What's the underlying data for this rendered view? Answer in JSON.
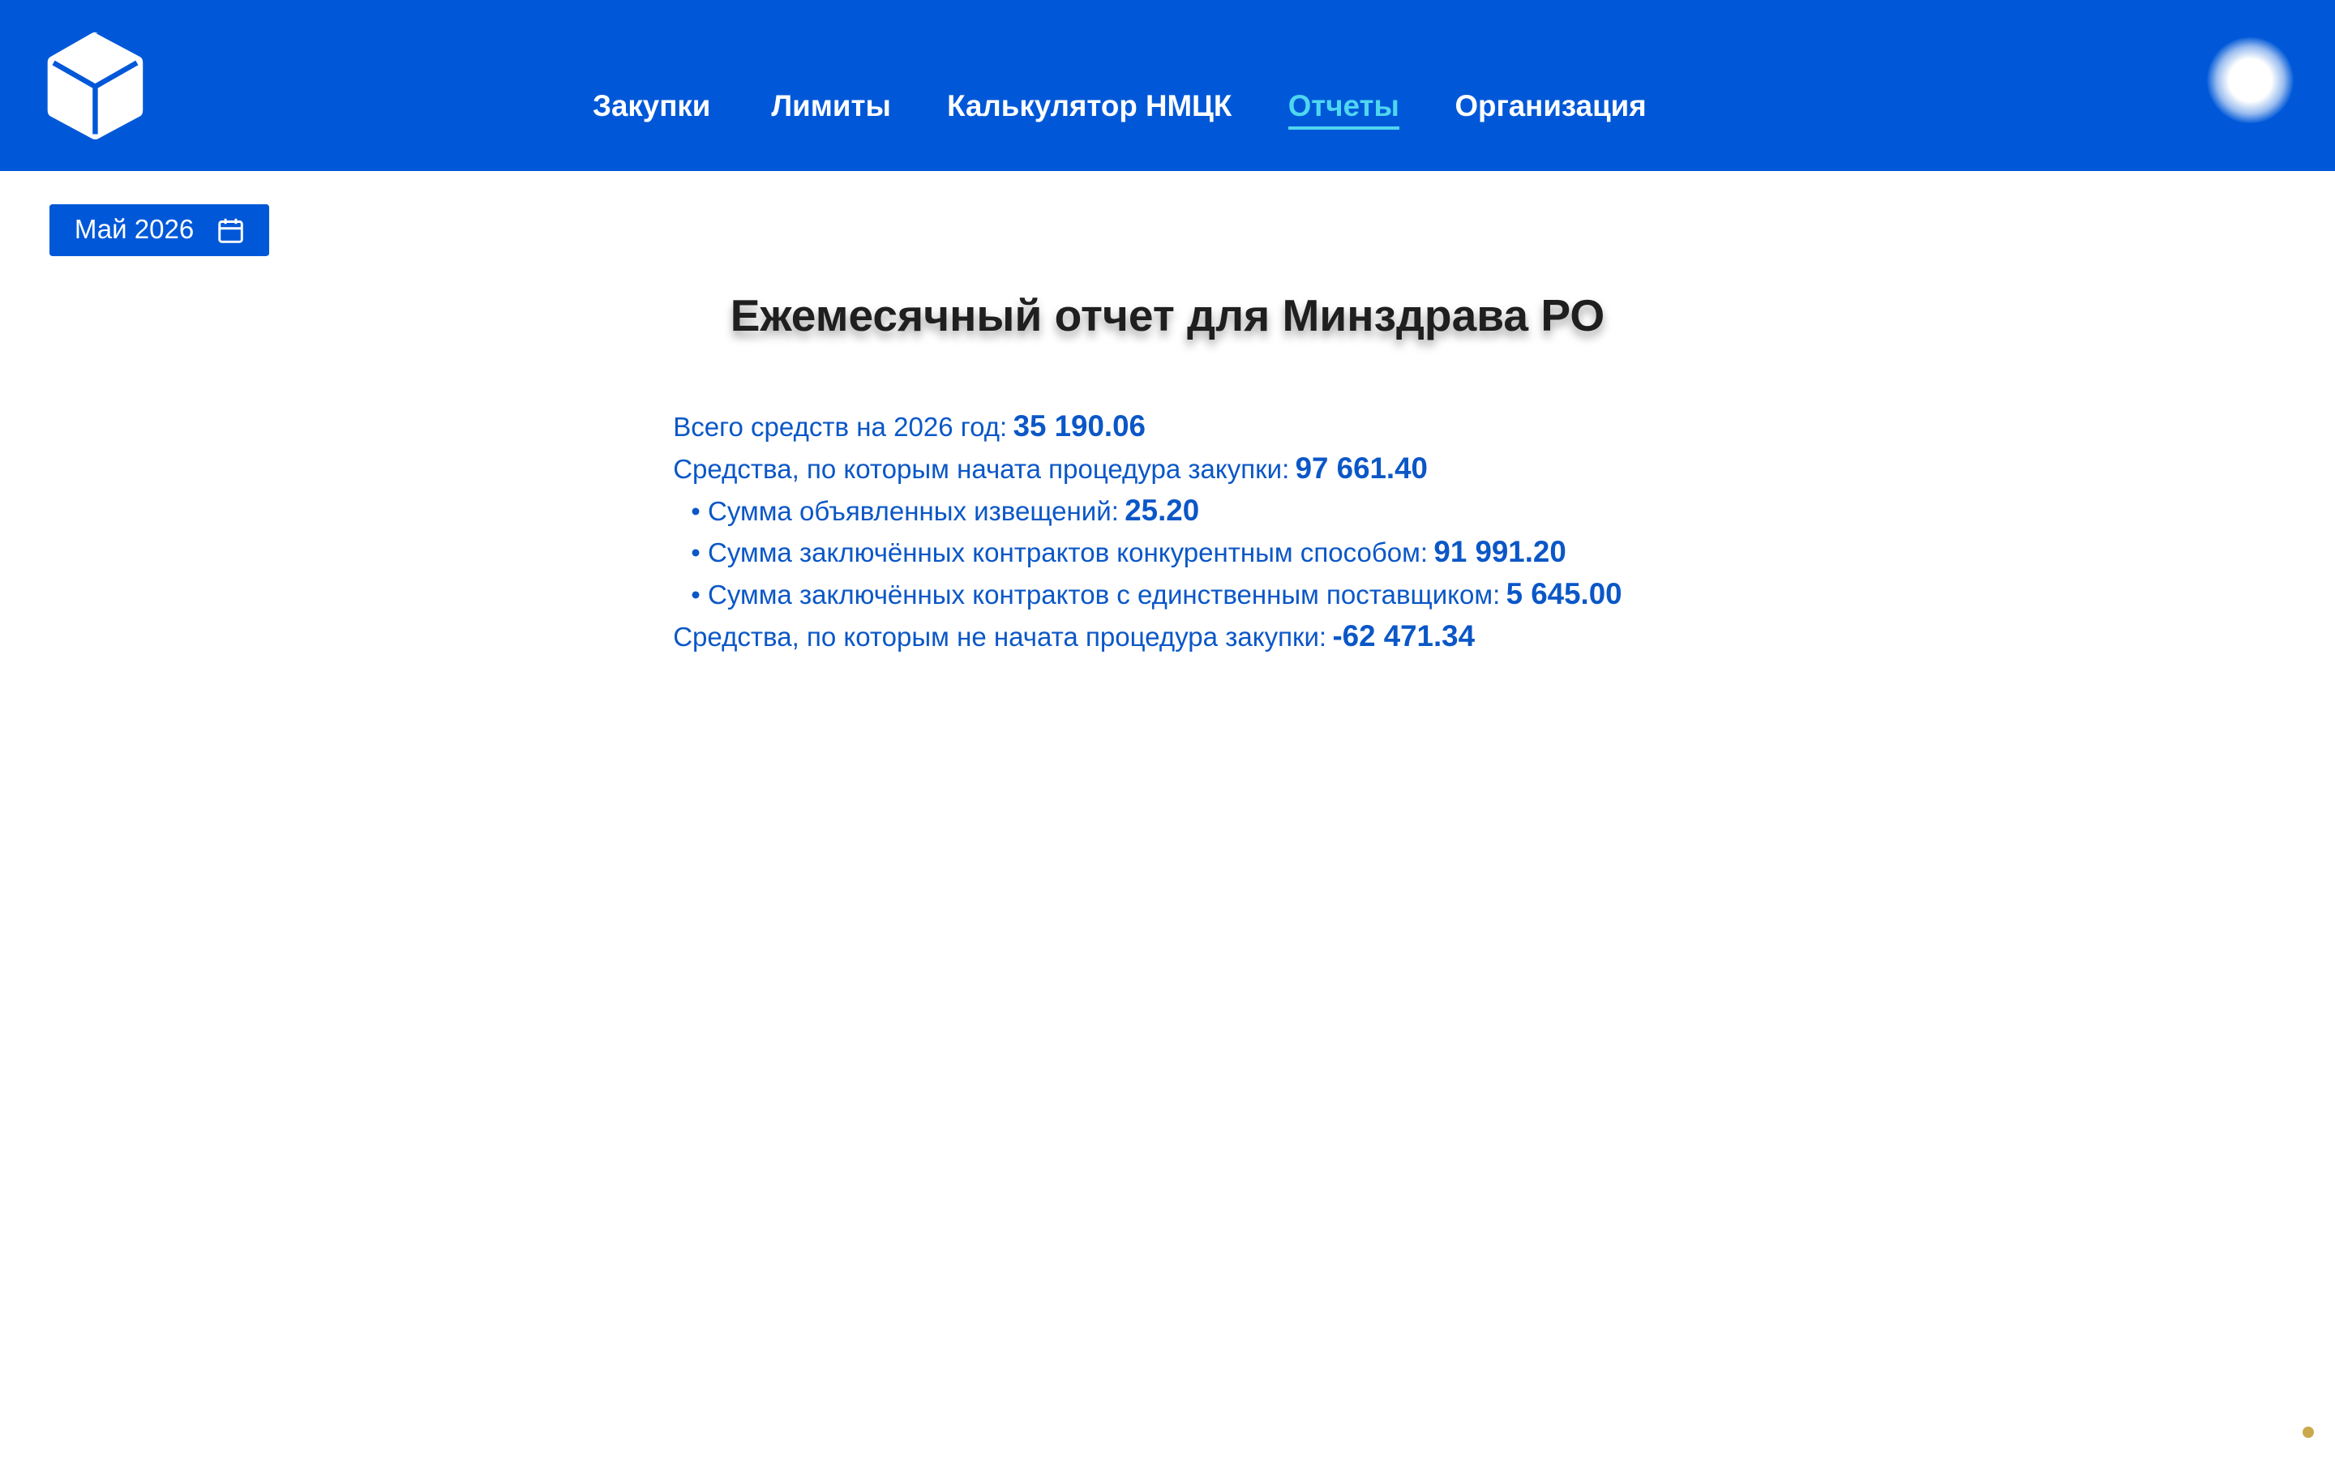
{
  "nav": {
    "items": [
      {
        "label": "Закупки"
      },
      {
        "label": "Лимиты"
      },
      {
        "label": "Калькулятор НМЦК"
      },
      {
        "label": "Отчеты",
        "active": true
      },
      {
        "label": "Организация"
      }
    ]
  },
  "period_picker": {
    "label": "Май 2026",
    "icon": "calendar-icon"
  },
  "report": {
    "title": "Ежемесячный отчет для Минздрава РО",
    "rows": [
      {
        "label": "Всего средств на 2026 год:",
        "value": "35 190.06",
        "bullet": false
      },
      {
        "label": "Средства, по которым начата процедура закупки:",
        "value": "97 661.40",
        "bullet": false
      },
      {
        "label": "• Сумма объявленных извещений:",
        "value": "25.20",
        "bullet": true
      },
      {
        "label": "• Сумма заключённых контрактов конкурентным способом:",
        "value": "91 991.20",
        "bullet": true
      },
      {
        "label": "• Сумма заключённых контрактов с единственным поставщиком:",
        "value": "5 645.00",
        "bullet": true
      },
      {
        "label": "Средства, по которым не начата процедура закупки:",
        "value": "-62 471.34",
        "bullet": false
      }
    ]
  },
  "colors": {
    "header_bg": "#0058d8",
    "active_nav": "#4fd6f0",
    "report_text": "#0b57c7"
  },
  "icons": {
    "logo": "cube-logo-icon",
    "user": "avatar"
  }
}
